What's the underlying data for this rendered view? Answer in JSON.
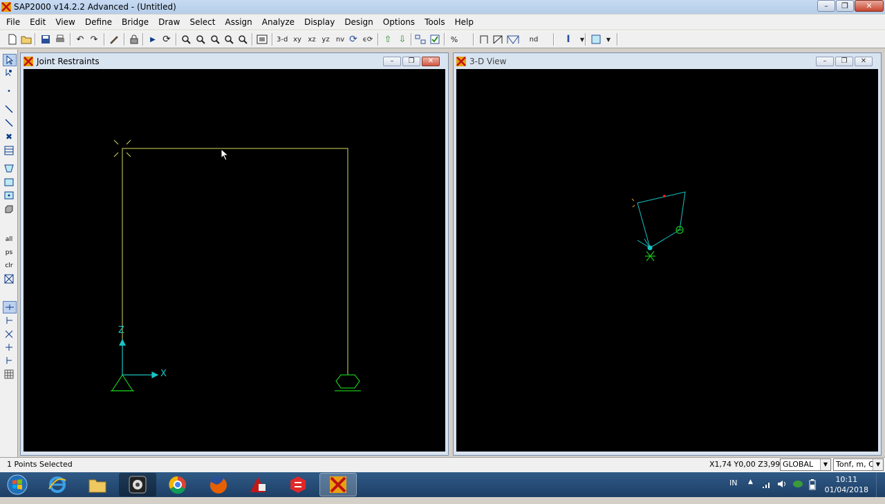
{
  "app": {
    "title": "SAP2000 v14.2.2 Advanced  - (Untitled)"
  },
  "menu": {
    "items": [
      "File",
      "Edit",
      "View",
      "Define",
      "Bridge",
      "Draw",
      "Select",
      "Assign",
      "Analyze",
      "Display",
      "Design",
      "Options",
      "Tools",
      "Help"
    ]
  },
  "toolbar": {
    "view_3d": "3-d",
    "view_xy": "xy",
    "view_xz": "xz",
    "view_yz": "yz",
    "view_nv": "nv",
    "nd": "nd"
  },
  "left_toolbar": {
    "all": "all",
    "ps": "ps",
    "clr": "clr"
  },
  "windows": {
    "left": {
      "title": "Joint Restraints",
      "axis_x": "X",
      "axis_z": "Z"
    },
    "right": {
      "title": "3-D View"
    }
  },
  "status": {
    "selection": "1 Points Selected",
    "coords": "X1,74  Y0,00  Z3,99",
    "coord_system": "GLOBAL",
    "units": "Tonf, m, C"
  },
  "taskbar": {
    "language": "IN",
    "time": "10:11",
    "date": "01/04/2018"
  },
  "colors": {
    "frame": "#d8d860",
    "restraint": "#19c419",
    "axis": "#19c4c4",
    "canvas": "#000000"
  }
}
